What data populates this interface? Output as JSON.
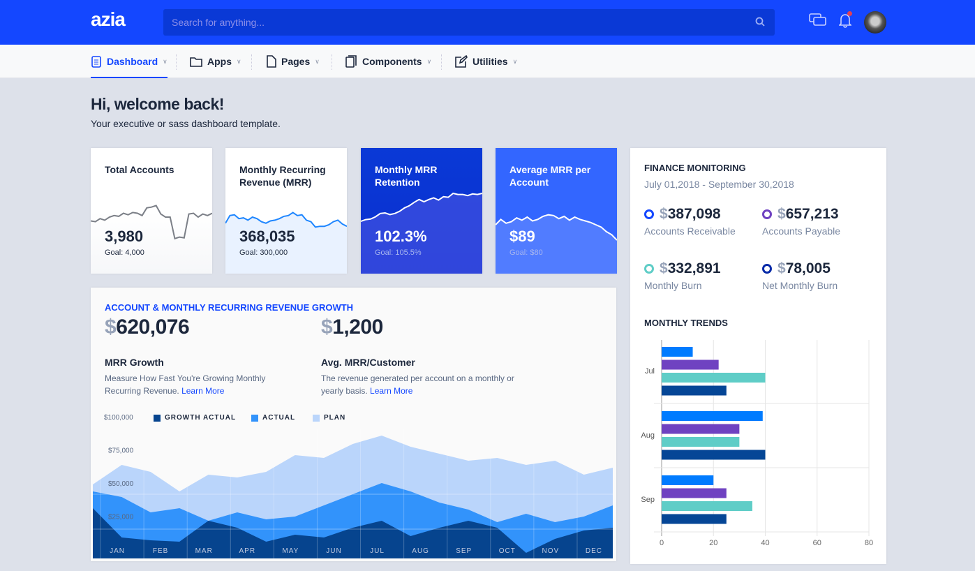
{
  "header": {
    "logo": "azia",
    "search_placeholder": "Search for anything...",
    "icons": [
      "search-icon",
      "chat-icon",
      "bell-icon",
      "avatar"
    ],
    "accent": "#1447ff"
  },
  "nav": {
    "items": [
      {
        "label": "Dashboard",
        "icon": "clipboard-icon",
        "active": true
      },
      {
        "label": "Apps",
        "icon": "folder-icon"
      },
      {
        "label": "Pages",
        "icon": "file-icon"
      },
      {
        "label": "Components",
        "icon": "copy-icon"
      },
      {
        "label": "Utilities",
        "icon": "edit-icon"
      }
    ]
  },
  "welcome": {
    "title": "Hi, welcome back!",
    "subtitle": "Your executive or sass dashboard template."
  },
  "kpis": [
    {
      "title": "Total Accounts",
      "value": "3,980",
      "goal": "Goal: 4,000",
      "spark": [
        5,
        4,
        8,
        6,
        10,
        12,
        11,
        15,
        13,
        16,
        15,
        12,
        22,
        23,
        25,
        14,
        10,
        10,
        -18,
        -16,
        -17,
        14,
        15,
        10,
        14,
        12,
        15
      ]
    },
    {
      "title": "Monthly Recurring Revenue (MRR)",
      "value": "368,035",
      "goal": "Goal: 300,000",
      "spark": [
        2,
        12,
        13,
        8,
        9,
        6,
        10,
        8,
        4,
        2,
        5,
        6,
        8,
        11,
        12,
        16,
        12,
        13,
        6,
        4,
        -3,
        -2,
        -2,
        0,
        4,
        6,
        1,
        -2
      ]
    },
    {
      "title": "Monthly MRR Retention",
      "value": "102.3%",
      "goal": "Goal: 105.5%",
      "spark": [
        0,
        3,
        4,
        8,
        14,
        15,
        12,
        14,
        18,
        24,
        28,
        34,
        39,
        35,
        39,
        42,
        38,
        44,
        43,
        50,
        48,
        48,
        46,
        49,
        48,
        50
      ]
    },
    {
      "title": "Average MRR per Account",
      "value": "$89",
      "goal": "Goal: $80",
      "spark": [
        0,
        7,
        2,
        4,
        9,
        6,
        10,
        5,
        7,
        11,
        13,
        12,
        8,
        11,
        6,
        10,
        7,
        5,
        3,
        0,
        -3,
        -9,
        -13,
        -20
      ]
    }
  ],
  "growth": {
    "title": "ACCOUNT & MONTHLY RECURRING REVENUE GROWTH",
    "mrr": {
      "currency": "$",
      "value": "620,076",
      "label": "MRR Growth",
      "desc": "Measure How Fast You're Growing Monthly Recurring Revenue.",
      "link": "Learn More"
    },
    "avg": {
      "currency": "$",
      "value": "1,200",
      "label": "Avg. MRR/Customer",
      "desc": "The revenue generated per account on a monthly or yearly basis.",
      "link": "Learn More"
    }
  },
  "chart_data": [
    {
      "type": "area",
      "yticks": [
        "$100,000",
        "$75,000",
        "$50,000",
        "$25,000"
      ],
      "ylim": [
        0,
        100000
      ],
      "categories": [
        "JAN",
        "FEB",
        "MAR",
        "APR",
        "MAY",
        "JUN",
        "JUL",
        "AUG",
        "SEP",
        "OCT",
        "NOV",
        "DEC"
      ],
      "series": [
        {
          "name": "PLAN",
          "color": "#bad5fb",
          "values": [
            53000,
            67000,
            62000,
            48000,
            60000,
            58000,
            62000,
            74000,
            72000,
            82000,
            88000,
            80000,
            75000,
            70000,
            72000,
            67000,
            70000,
            60000,
            65000
          ]
        },
        {
          "name": "ACTUAL",
          "color": "#3293fb",
          "values": [
            48000,
            44000,
            33000,
            36000,
            27000,
            33000,
            28000,
            30000,
            38000,
            46000,
            54000,
            48000,
            40000,
            35000,
            26000,
            32000,
            26000,
            30000,
            38000
          ]
        },
        {
          "name": "GROWTH ACTUAL",
          "color": "#06448e",
          "values": [
            36000,
            15000,
            13000,
            12000,
            27000,
            22000,
            12000,
            17000,
            15000,
            22000,
            27000,
            16000,
            22000,
            27000,
            22000,
            4000,
            14000,
            20000,
            22000
          ]
        }
      ]
    },
    {
      "type": "bar",
      "orientation": "horizontal",
      "title": "MONTHLY TRENDS",
      "categories": [
        "Jul",
        "Aug",
        "Sep"
      ],
      "xlim": [
        0,
        80
      ],
      "xticks": [
        "0",
        "20",
        "40",
        "60",
        "80"
      ],
      "series": [
        {
          "color": "#007bff",
          "values": [
            12,
            39,
            20
          ]
        },
        {
          "color": "#6f42c1",
          "values": [
            22,
            30,
            25
          ]
        },
        {
          "color": "#5fcdc7",
          "values": [
            40,
            30,
            35
          ]
        },
        {
          "color": "#054696",
          "values": [
            25,
            40,
            25
          ]
        }
      ]
    }
  ],
  "finance": {
    "title": "FINANCE MONITORING",
    "date": "July 01,2018 - September 30,2018",
    "items": [
      {
        "value": "387,098",
        "label": "Accounts Receivable",
        "color": "#1447ff"
      },
      {
        "value": "657,213",
        "label": "Accounts Payable",
        "color": "#6f42c1"
      },
      {
        "value": "332,891",
        "label": "Monthly Burn",
        "color": "#5fcdc7"
      },
      {
        "value": "78,005",
        "label": "Net Monthly Burn",
        "color": "#062aa8"
      }
    ],
    "currency": "$"
  }
}
